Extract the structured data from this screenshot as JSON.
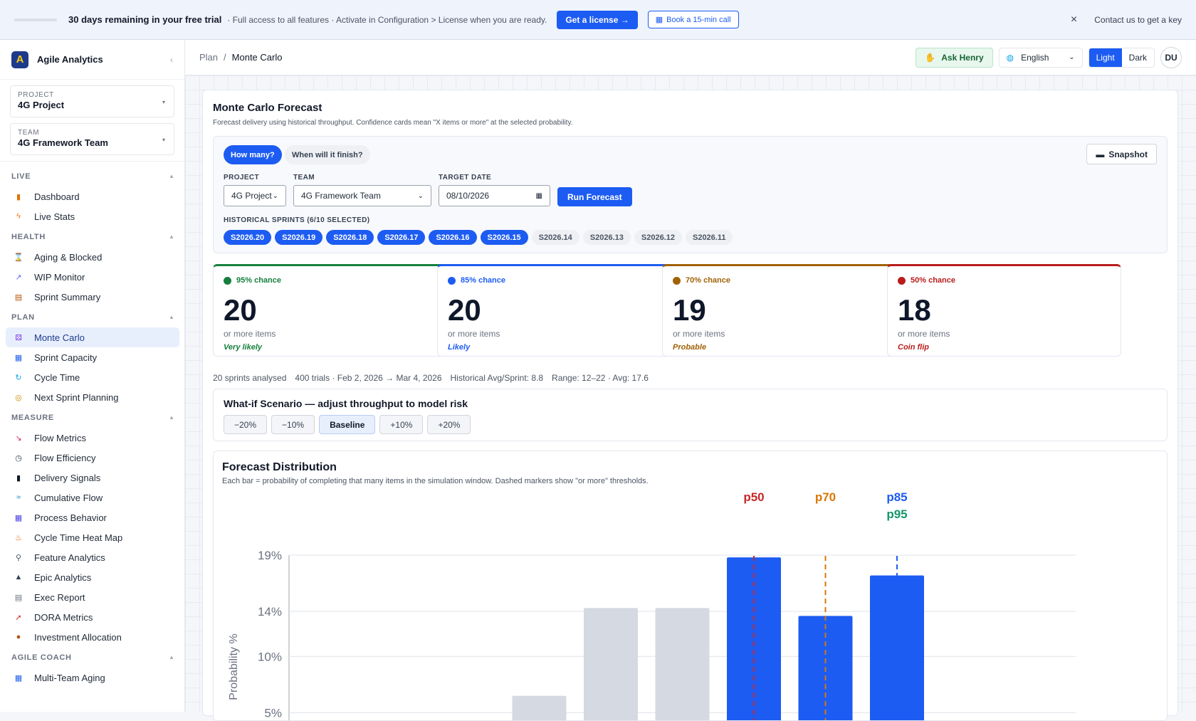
{
  "banner": {
    "days": "30 days remaining in your free trial",
    "message": "· Full access to all features · Activate in Configuration > License when you are ready.",
    "license_btn": "Get a license →",
    "call_btn": "Book a 15-min call",
    "close": "×",
    "contact": "Contact us to get a key"
  },
  "app": {
    "logo": "A",
    "name": "Agile Analytics",
    "collapse": "‹"
  },
  "pickers": [
    {
      "label": "PROJECT",
      "value": "4G Project"
    },
    {
      "label": "TEAM",
      "value": "4G Framework Team"
    }
  ],
  "nav": {
    "live": {
      "title": "LIVE",
      "items": [
        {
          "label": "Dashboard",
          "icon": "bar-chart-icon"
        },
        {
          "label": "Live Stats",
          "icon": "lightning-icon"
        }
      ]
    },
    "health": {
      "title": "HEALTH",
      "items": [
        {
          "label": "Aging & Blocked",
          "icon": "hourglass-icon"
        },
        {
          "label": "WIP Monitor",
          "icon": "trend-icon"
        },
        {
          "label": "Sprint Summary",
          "icon": "clipboard-icon"
        }
      ]
    },
    "plan": {
      "title": "PLAN",
      "items": [
        {
          "label": "Monte Carlo",
          "icon": "dice-icon"
        },
        {
          "label": "Sprint Capacity",
          "icon": "calendar-icon"
        },
        {
          "label": "Cycle Time",
          "icon": "refresh-icon"
        },
        {
          "label": "Next Sprint Planning",
          "icon": "compass-icon"
        }
      ]
    },
    "measure": {
      "title": "MEASURE",
      "items": [
        {
          "label": "Flow Metrics",
          "icon": "chart-down-icon"
        },
        {
          "label": "Flow Efficiency",
          "icon": "stopwatch-icon"
        },
        {
          "label": "Delivery Signals",
          "icon": "traffic-light-icon"
        },
        {
          "label": "Cumulative Flow",
          "icon": "wave-icon"
        },
        {
          "label": "Process Behavior",
          "icon": "grid-icon"
        },
        {
          "label": "Cycle Time Heat Map",
          "icon": "fire-icon"
        },
        {
          "label": "Feature Analytics",
          "icon": "microscope-icon"
        },
        {
          "label": "Epic Analytics",
          "icon": "mountain-icon"
        },
        {
          "label": "Exec Report",
          "icon": "report-icon"
        },
        {
          "label": "DORA Metrics",
          "icon": "rocket-icon"
        },
        {
          "label": "Investment Allocation",
          "icon": "money-bag-icon"
        }
      ]
    },
    "coach": {
      "title": "AGILE COACH",
      "items": [
        {
          "label": "Multi-Team Aging",
          "icon": "calendar-icon"
        }
      ]
    }
  },
  "header": {
    "crumb_parent": "Plan",
    "crumb_sep": "/",
    "crumb_current": "Monte Carlo",
    "ask": "Ask Henry",
    "language": "English",
    "theme_light": "Light",
    "theme_dark": "Dark",
    "avatar": "DU"
  },
  "forecast": {
    "title": "Monte Carlo Forecast",
    "subtitle": "Forecast delivery using historical throughput. Confidence cards mean \"X items or more\" at the selected probability.",
    "mode_how_many": "How many?",
    "mode_when": "When will it finish?",
    "snapshot": "Snapshot",
    "project_label": "PROJECT",
    "project_value": "4G Project",
    "team_label": "TEAM",
    "team_value": "4G Framework Team",
    "date_label": "TARGET DATE",
    "date_value": "08/10/2026",
    "run": "Run Forecast",
    "sprints_label": "HISTORICAL SPRINTS (6/10 SELECTED)",
    "sprints": [
      {
        "name": "S2026.20",
        "selected": true
      },
      {
        "name": "S2026.19",
        "selected": true
      },
      {
        "name": "S2026.18",
        "selected": true
      },
      {
        "name": "S2026.17",
        "selected": true
      },
      {
        "name": "S2026.16",
        "selected": true
      },
      {
        "name": "S2026.15",
        "selected": true
      },
      {
        "name": "S2026.14",
        "selected": false
      },
      {
        "name": "S2026.13",
        "selected": false
      },
      {
        "name": "S2026.12",
        "selected": false
      },
      {
        "name": "S2026.11",
        "selected": false
      }
    ]
  },
  "confidence": [
    {
      "chance": "95% chance",
      "value": "20",
      "sub": "or more items",
      "qual": "Very likely",
      "color": "#15803d"
    },
    {
      "chance": "85% chance",
      "value": "20",
      "sub": "or more items",
      "qual": "Likely",
      "color": "#1d5cf2"
    },
    {
      "chance": "70% chance",
      "value": "19",
      "sub": "or more items",
      "qual": "Probable",
      "color": "#a16207"
    },
    {
      "chance": "50% chance",
      "value": "18",
      "sub": "or more items",
      "qual": "Coin flip",
      "color": "#b91c1c"
    }
  ],
  "stats": {
    "analysed": "20 sprints analysed",
    "trials": "400 trials · Feb 2, 2026 → Mar 4, 2026",
    "avg": "Historical Avg/Sprint: 8.8",
    "range": "Range: 12–22 · Avg: 17.6"
  },
  "whatif": {
    "title": "What-if Scenario — adjust throughput to model risk",
    "options": [
      "−20%",
      "−10%",
      "Baseline",
      "+10%",
      "+20%"
    ],
    "selected": 2
  },
  "distribution": {
    "title": "Forecast Distribution",
    "subtitle": "Each bar = probability of completing that many items in the simulation window. Dashed markers show \"or more\" thresholds."
  },
  "chart_data": {
    "type": "bar",
    "ylabel": "Probability %",
    "yticks": [
      5,
      10,
      14,
      19
    ],
    "ytick_labels": [
      "5%",
      "10%",
      "14%",
      "19%"
    ],
    "ylim": [
      4.2,
      19
    ],
    "bars": [
      {
        "value": 0,
        "highlight": false
      },
      {
        "value": 0,
        "highlight": false
      },
      {
        "value": 0,
        "highlight": false
      },
      {
        "value": 6.5,
        "highlight": false
      },
      {
        "value": 14.3,
        "highlight": false
      },
      {
        "value": 14.3,
        "highlight": false
      },
      {
        "value": 18.8,
        "highlight": true
      },
      {
        "value": 13.6,
        "highlight": true
      },
      {
        "value": 17.2,
        "highlight": true
      }
    ],
    "markers": [
      {
        "label": "p50",
        "bar_index": 6,
        "color": "#c62828",
        "row": 0
      },
      {
        "label": "p70",
        "bar_index": 7,
        "color": "#d97706",
        "row": 0
      },
      {
        "label": "p85",
        "bar_index": 8,
        "color": "#1d5cf2",
        "row": 0
      },
      {
        "label": "p95",
        "bar_index": 8,
        "color": "#16956a",
        "row": 1
      }
    ],
    "colors": {
      "highlight": "#1d5cf2",
      "muted": "#d4d9e2",
      "grid": "#dfe3ea"
    }
  }
}
